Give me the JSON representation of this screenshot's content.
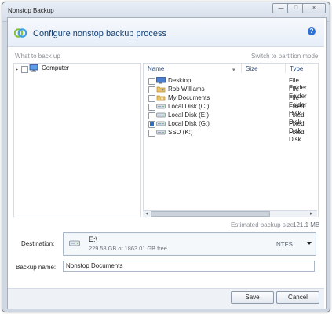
{
  "window": {
    "title": "Nonstop Backup",
    "controls": {
      "minimize": "—",
      "maximize": "□",
      "close": "×"
    }
  },
  "header": {
    "title": "Configure nonstop backup process",
    "help_icon": "?"
  },
  "sections": {
    "what_to_back_up": "What to back up",
    "switch_mode": "Switch to partition mode"
  },
  "left_tree": {
    "computer_label": "Computer"
  },
  "table": {
    "columns": {
      "name": "Name",
      "size": "Size",
      "type": "Type"
    },
    "rows": [
      {
        "name": "Desktop",
        "type": "File Folder",
        "icon": "desktop-icon",
        "checked": false
      },
      {
        "name": "Rob Williams",
        "type": "File Folder",
        "icon": "user-folder-icon",
        "checked": false
      },
      {
        "name": "My Documents",
        "type": "File Folder",
        "icon": "documents-icon",
        "checked": false
      },
      {
        "name": "Local Disk (C:)",
        "type": "Fixed Disk",
        "icon": "drive-icon",
        "checked": false
      },
      {
        "name": "Local Disk (E:)",
        "type": "Fixed Disk",
        "icon": "drive-icon",
        "checked": false
      },
      {
        "name": "Local Disk (G:)",
        "type": "Fixed Disk",
        "icon": "drive-icon",
        "checked": true
      },
      {
        "name": "SSD (K:)",
        "type": "Fixed Disk",
        "icon": "drive-icon",
        "checked": false
      }
    ]
  },
  "estimate": {
    "label": "Estimated backup size:",
    "value": "121.1 MB"
  },
  "destination": {
    "label": "Destination:",
    "path": "E:\\",
    "free_text": "229.58 GB of 1863.01 GB free",
    "filesystem": "NTFS"
  },
  "backup_name": {
    "label": "Backup name:",
    "value": "Nonstop Documents"
  },
  "buttons": {
    "save": "Save",
    "cancel": "Cancel"
  },
  "colors": {
    "accent": "#2f6fbd",
    "header_text": "#123f72"
  }
}
